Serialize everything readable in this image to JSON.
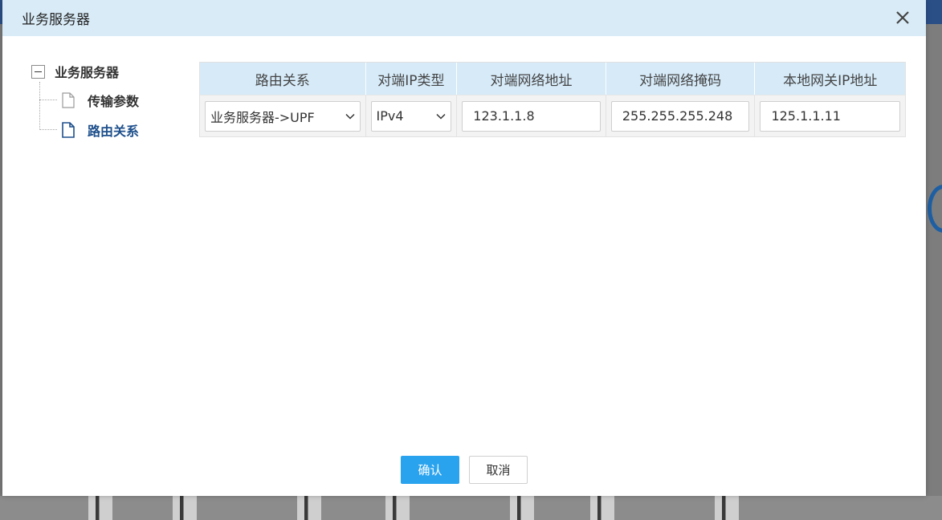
{
  "modal": {
    "title": "业务服务器",
    "close_icon": "close-icon"
  },
  "tree": {
    "root_label": "业务服务器",
    "items": [
      {
        "label": "传输参数",
        "icon": "document-icon",
        "active": false
      },
      {
        "label": "路由关系",
        "icon": "document-icon",
        "active": true
      }
    ]
  },
  "table": {
    "headers": [
      "路由关系",
      "对端IP类型",
      "对端网络地址",
      "对端网络掩码",
      "本地网关IP地址"
    ],
    "rows": [
      {
        "route": "业务服务器->UPF",
        "ip_type": "IPv4",
        "peer_address": "123.1.1.8",
        "peer_mask": "255.255.255.248",
        "local_gateway": "125.1.1.11"
      }
    ]
  },
  "buttons": {
    "confirm": "确认",
    "cancel": "取消"
  },
  "colors": {
    "header_bg": "#d8ebf7",
    "table_header_bg": "#d6eaf8",
    "primary": "#2aa3ef",
    "active_tree_text": "#1d4f8b"
  }
}
